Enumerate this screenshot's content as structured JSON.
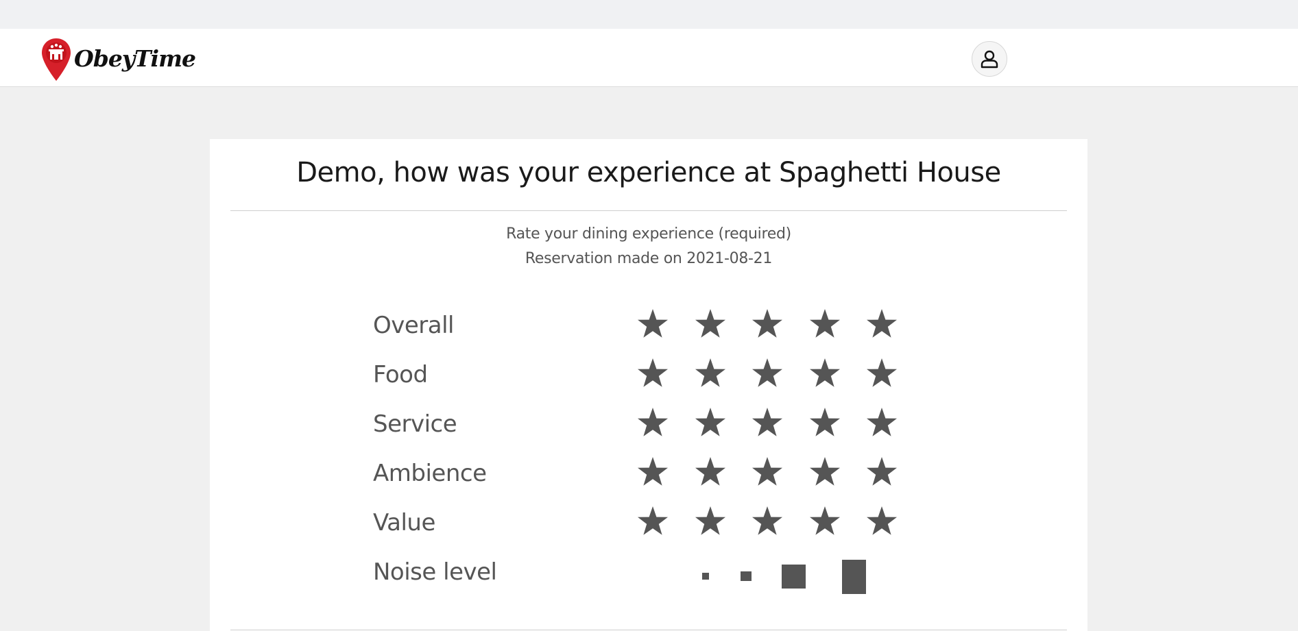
{
  "app": {
    "logo_text": "ObeyTime"
  },
  "navbar": {
    "user_icon": "user-icon"
  },
  "review": {
    "title": "Demo, how was your experience at Spaghetti House",
    "instruction": "Rate your dining experience (required)",
    "reservation_text": "Reservation made on 2021-08-21",
    "categories": [
      {
        "label": "Overall",
        "max_stars": 5,
        "rating": 0
      },
      {
        "label": "Food",
        "max_stars": 5,
        "rating": 0
      },
      {
        "label": "Service",
        "max_stars": 5,
        "rating": 0
      },
      {
        "label": "Ambience",
        "max_stars": 5,
        "rating": 0
      },
      {
        "label": "Value",
        "max_stars": 5,
        "rating": 0
      }
    ],
    "noise_level": {
      "label": "Noise level",
      "levels": 4,
      "selected": 0
    }
  },
  "colors": {
    "star": "#555555",
    "brand_red": "#d6202a",
    "text": "#555555",
    "title": "#1a1a1a"
  }
}
